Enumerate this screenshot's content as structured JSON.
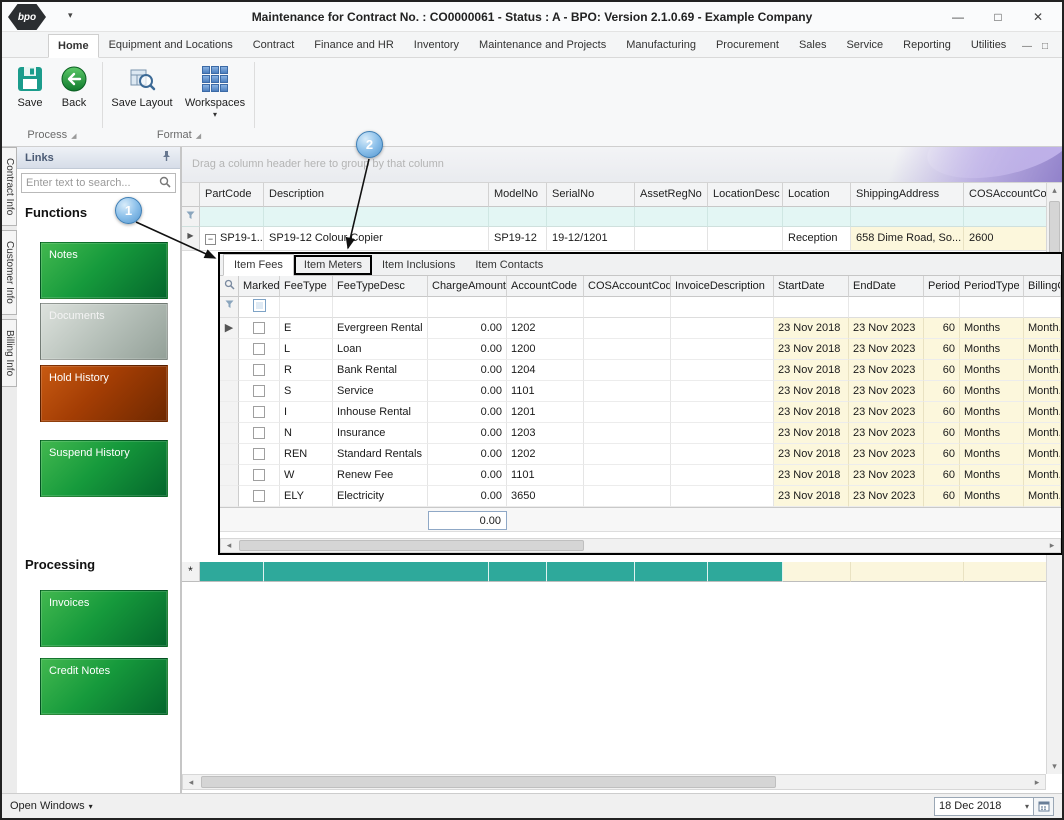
{
  "window": {
    "title": "Maintenance for Contract No. : CO0000061 - Status : A - BPO: Version 2.1.0.69 - Example Company",
    "logo": "bpo"
  },
  "icons": {
    "caret_down": "▾",
    "window_minimize": "—",
    "window_maximize": "□",
    "window_close": "✕",
    "ribbon_minimize": "—",
    "ribbon_expand": "□",
    "row_marker": "▶",
    "collapse_row": "−",
    "new_row": "*",
    "group_launcher": "◢",
    "scroll_left": "◂",
    "scroll_right": "▸",
    "scroll_up": "▴",
    "scroll_down": "▾"
  },
  "menu": {
    "tabs": [
      "Home",
      "Equipment and Locations",
      "Contract",
      "Finance and HR",
      "Inventory",
      "Maintenance and Projects",
      "Manufacturing",
      "Procurement",
      "Sales",
      "Service",
      "Reporting",
      "Utilities"
    ]
  },
  "ribbon": {
    "save": "Save",
    "back": "Back",
    "save_layout": "Save Layout",
    "workspaces": "Workspaces",
    "group_process": "Process",
    "group_format": "Format"
  },
  "side_tabs": [
    "Contract Info",
    "Customer Info",
    "Billing Info"
  ],
  "sidebar": {
    "links_title": "Links",
    "search_placeholder": "Enter text to search...",
    "functions_title": "Functions",
    "notes": "Notes",
    "documents": "Documents",
    "hold_history": "Hold History",
    "suspend_history": "Suspend History",
    "processing_title": "Processing",
    "invoices": "Invoices",
    "credit_notes": "Credit Notes"
  },
  "main": {
    "group_hint": "Drag a column header here to group by that column",
    "grid": {
      "columns": [
        "PartCode",
        "Description",
        "ModelNo",
        "SerialNo",
        "AssetRegNo",
        "LocationDesc",
        "Location",
        "ShippingAddress",
        "COSAccountCode"
      ],
      "row": [
        "SP19-1...",
        "SP19-12 Colour Copier",
        "SP19-12",
        "19-12/1201",
        "",
        "",
        "Reception",
        "658 Dime Road, So...",
        "2600"
      ]
    },
    "detail": {
      "tabs": [
        "Item Fees",
        "Item Meters",
        "Item Inclusions",
        "Item Contacts"
      ],
      "columns": [
        "Marked",
        "FeeType",
        "FeeTypeDesc",
        "ChargeAmount",
        "AccountCode",
        "COSAccountCode",
        "InvoiceDescription",
        "StartDate",
        "EndDate",
        "Period",
        "PeriodType",
        "BillingC..."
      ],
      "rows": [
        [
          "E",
          "Evergreen Rental",
          "0.00",
          "1202",
          "",
          "",
          "23 Nov 2018",
          "23 Nov 2023",
          "60",
          "Months",
          "Month..."
        ],
        [
          "L",
          "Loan",
          "0.00",
          "1200",
          "",
          "",
          "23 Nov 2018",
          "23 Nov 2023",
          "60",
          "Months",
          "Month..."
        ],
        [
          "R",
          "Bank Rental",
          "0.00",
          "1204",
          "",
          "",
          "23 Nov 2018",
          "23 Nov 2023",
          "60",
          "Months",
          "Month..."
        ],
        [
          "S",
          "Service",
          "0.00",
          "1101",
          "",
          "",
          "23 Nov 2018",
          "23 Nov 2023",
          "60",
          "Months",
          "Month..."
        ],
        [
          "I",
          "Inhouse Rental",
          "0.00",
          "1201",
          "",
          "",
          "23 Nov 2018",
          "23 Nov 2023",
          "60",
          "Months",
          "Month..."
        ],
        [
          "N",
          "Insurance",
          "0.00",
          "1203",
          "",
          "",
          "23 Nov 2018",
          "23 Nov 2023",
          "60",
          "Months",
          "Month..."
        ],
        [
          "REN",
          "Standard Rentals",
          "0.00",
          "1202",
          "",
          "",
          "23 Nov 2018",
          "23 Nov 2023",
          "60",
          "Months",
          "Month..."
        ],
        [
          "W",
          "Renew Fee",
          "0.00",
          "1101",
          "",
          "",
          "23 Nov 2018",
          "23 Nov 2023",
          "60",
          "Months",
          "Month..."
        ],
        [
          "ELY",
          "Electricity",
          "0.00",
          "3650",
          "",
          "",
          "23 Nov 2018",
          "23 Nov 2023",
          "60",
          "Months",
          "Month..."
        ]
      ],
      "footer_sum": "0.00"
    }
  },
  "annotations": {
    "callout1": "1",
    "callout2": "2"
  },
  "statusbar": {
    "open_windows": "Open Windows",
    "date": "18 Dec 2018"
  }
}
